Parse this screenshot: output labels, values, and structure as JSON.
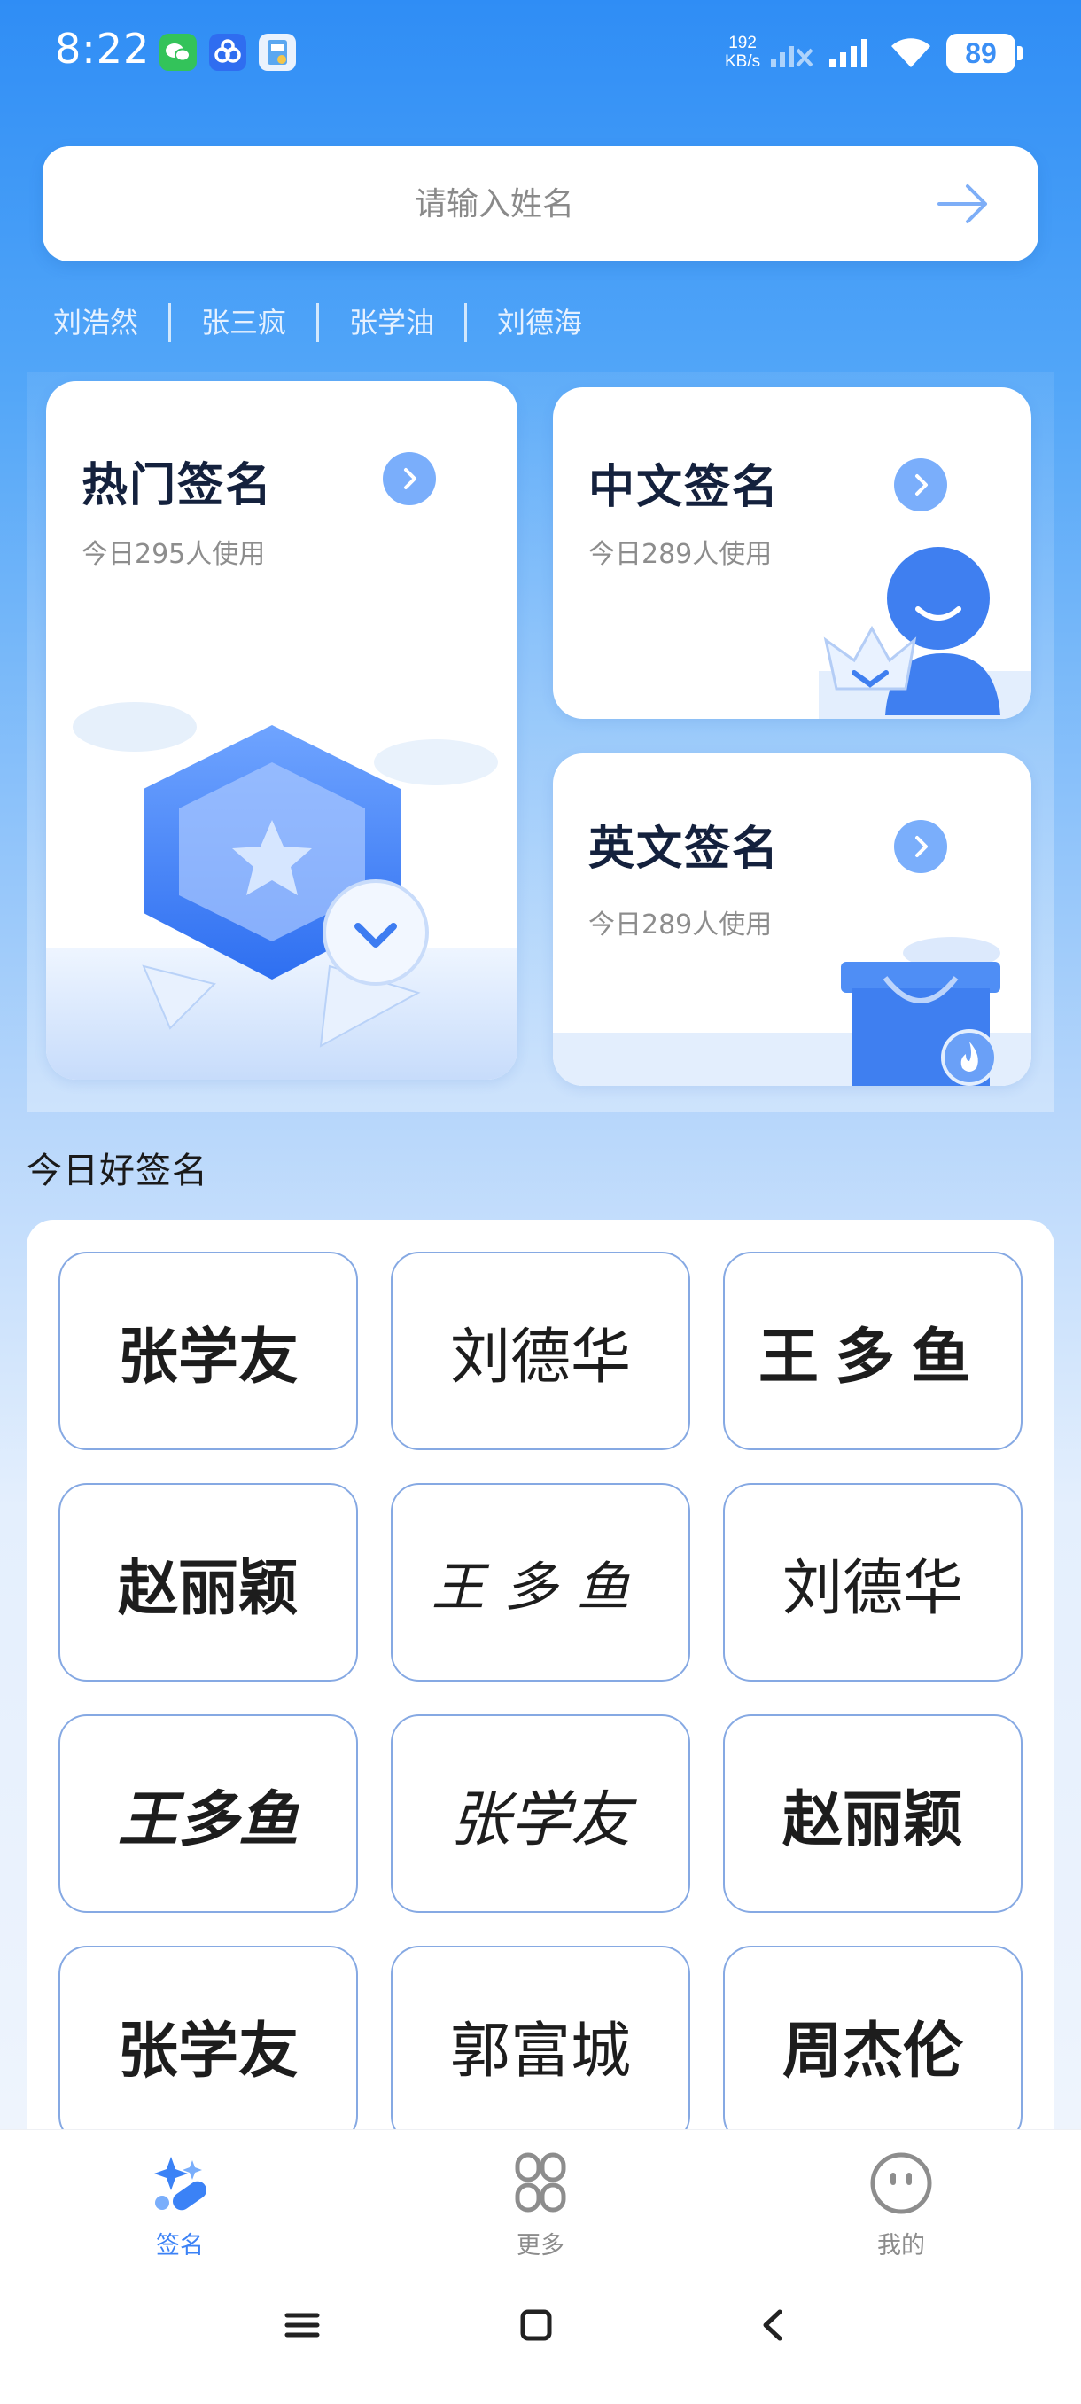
{
  "status_bar": {
    "time": "8:22",
    "net_speed_value": "192",
    "net_speed_unit": "KB/s",
    "battery": "89"
  },
  "search": {
    "placeholder": "请输入姓名"
  },
  "suggestions": [
    "刘浩然",
    "张三疯",
    "张学油",
    "刘德海"
  ],
  "cards": {
    "hot": {
      "title": "热门签名",
      "subtitle": "今日295人使用"
    },
    "chinese": {
      "title": "中文签名",
      "subtitle": "今日289人使用"
    },
    "english": {
      "title": "英文签名",
      "subtitle": "今日289人使用"
    }
  },
  "daily": {
    "title": "今日好签名",
    "signatures": [
      "张学友",
      "刘德华",
      "王多鱼",
      "赵丽颖",
      "王多鱼",
      "刘德华",
      "王多鱼",
      "张学友",
      "赵丽颖",
      "张学友",
      "郭富城",
      "周杰伦"
    ]
  },
  "bottom_nav": {
    "items": [
      {
        "label": "签名",
        "icon": "signature-sparkle-icon",
        "active": true
      },
      {
        "label": "更多",
        "icon": "grid-more-icon",
        "active": false
      },
      {
        "label": "我的",
        "icon": "smiley-face-icon",
        "active": false
      }
    ]
  },
  "colors": {
    "accent": "#3b82f6",
    "tile_border": "#86a9e3",
    "card_go_button": "#7aaefb"
  }
}
